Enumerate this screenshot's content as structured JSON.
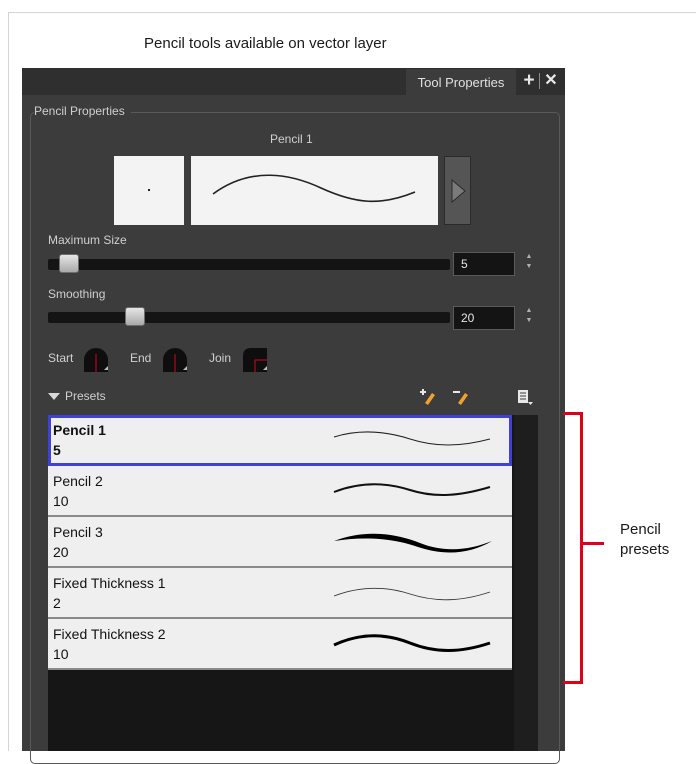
{
  "caption": "Pencil tools available on vector layer",
  "tab": {
    "label": "Tool Properties",
    "add_icon": "plus-icon",
    "close_icon": "close-icon"
  },
  "pencil_properties": {
    "group_title": "Pencil Properties",
    "current_preset": "Pencil 1",
    "maximum_size": {
      "label": "Maximum Size",
      "value": "5"
    },
    "smoothing": {
      "label": "Smoothing",
      "value": "20"
    },
    "start_label": "Start",
    "end_label": "End",
    "join_label": "Join"
  },
  "presets": {
    "header": "Presets",
    "items": [
      {
        "name": "Pencil 1",
        "size": "5",
        "selected": true
      },
      {
        "name": "Pencil 2",
        "size": "10",
        "selected": false
      },
      {
        "name": "Pencil 3",
        "size": "20",
        "selected": false
      },
      {
        "name": "Fixed Thickness 1",
        "size": "2",
        "selected": false
      },
      {
        "name": "Fixed Thickness 2",
        "size": "10",
        "selected": false
      }
    ]
  },
  "annotation": {
    "line1": "Pencil",
    "line2": "presets",
    "color": "#e0001a"
  }
}
